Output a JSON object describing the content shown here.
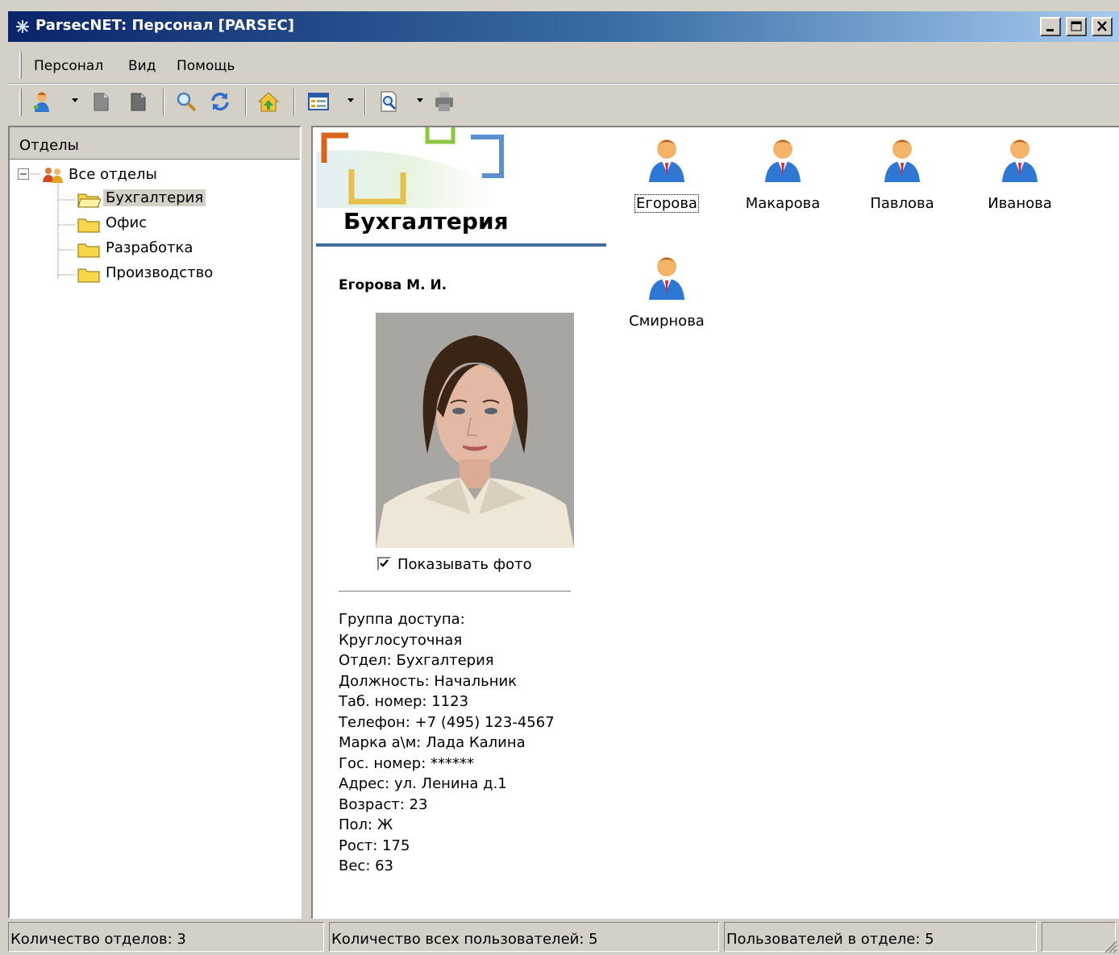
{
  "window": {
    "title": "ParsecNET: Персонал [PARSEC]"
  },
  "menu": {
    "items": [
      "Персонал",
      "Вид",
      "Помощь"
    ]
  },
  "toolbar": {
    "buttons": [
      "add-person-icon",
      "page-icon",
      "page-dark-icon",
      "search-icon",
      "refresh-icon",
      "home-icon",
      "view-icon",
      "preview-icon",
      "print-icon"
    ]
  },
  "left_panel": {
    "header": "Отделы",
    "root": "Все отделы",
    "departments": [
      "Бухгалтерия",
      "Офис",
      "Разработка",
      "Производство"
    ],
    "selected_index": 0
  },
  "detail": {
    "department_title": "Бухгалтерия",
    "person_name": "Егорова М. И.",
    "show_photo_label": "Показывать фото",
    "show_photo_checked": true,
    "info_lines": [
      "Группа доступа:",
      "Круглосуточная",
      "Отдел: Бухгалтерия",
      "Должность: Начальник",
      "Таб. номер: 1123",
      "Телефон: +7 (495) 123-4567",
      "Марка а\\м: Лада Калина",
      "Гос. номер: ******",
      "Адрес: ул. Ленина д.1",
      "Возраст: 23",
      "Пол: Ж",
      "Рост: 175",
      "Вес: 63"
    ]
  },
  "employees": [
    "Егорова",
    "Макарова",
    "Павлова",
    "Иванова",
    "Смирнова"
  ],
  "status_bar": {
    "dept_count": "Количество отделов: 3",
    "all_users": "Количество всех пользователей: 5",
    "dept_users": "Пользователей в отделе: 5"
  },
  "colors": {
    "title_start": "#0a246a",
    "title_end": "#a6caf0",
    "accent_line": "#41709f"
  }
}
